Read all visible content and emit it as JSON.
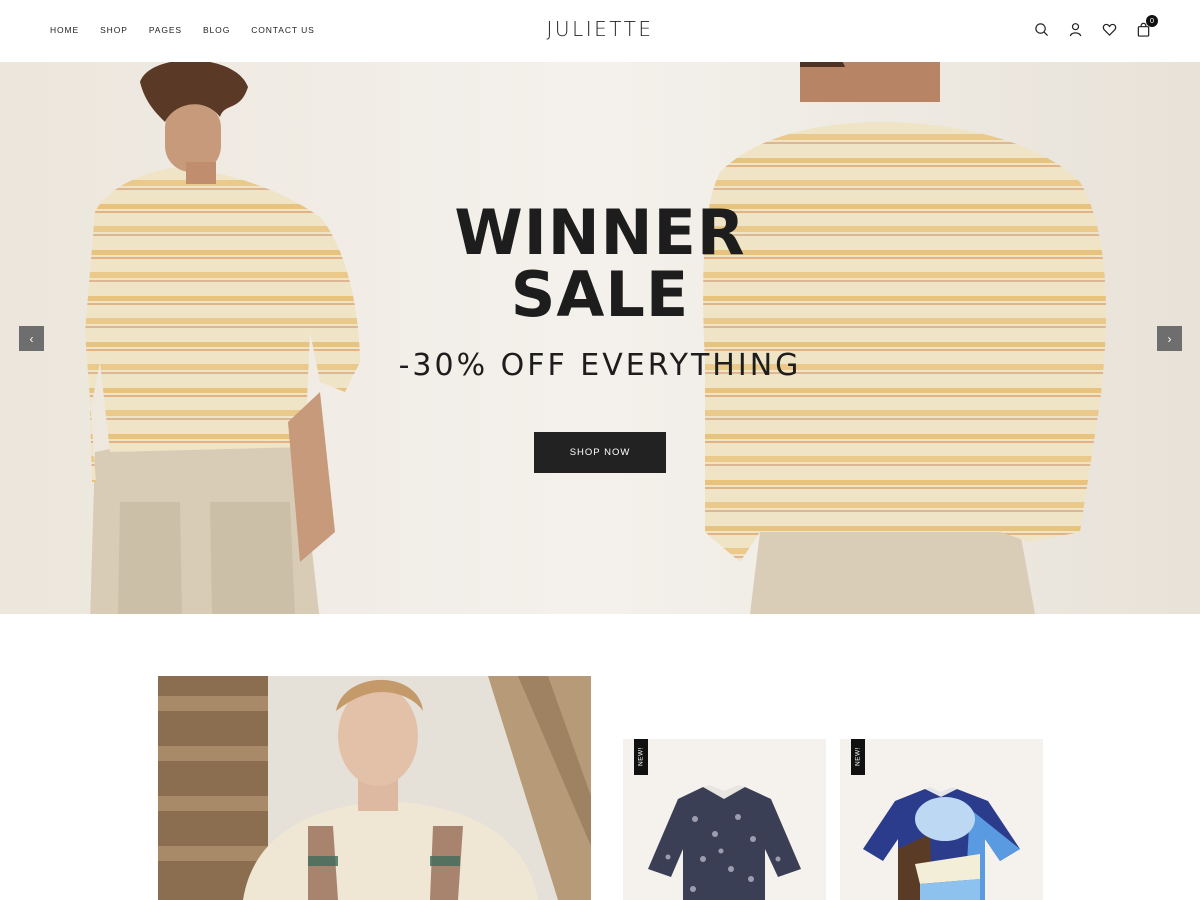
{
  "header": {
    "nav": [
      {
        "label": "HOME"
      },
      {
        "label": "SHOP"
      },
      {
        "label": "PAGES"
      },
      {
        "label": "BLOG"
      },
      {
        "label": "CONTACT US"
      }
    ],
    "logo": "JULIETTE",
    "icons": [
      "search-icon",
      "user-icon",
      "heart-icon",
      "bag-icon"
    ],
    "cart_count": "0"
  },
  "hero": {
    "title_line1": "WINNER",
    "title_line2": "SALE",
    "subtitle": "-30% OFF EVERYTHING",
    "cta": "SHOP NOW",
    "prev_arrow": "‹",
    "next_arrow": "›"
  },
  "products": [
    {
      "badge": "NEW!"
    },
    {
      "badge": "NEW!"
    }
  ],
  "colors": {
    "text": "#1f1f1f",
    "button_bg": "#222222",
    "arrow_bg": "#6e6e6e",
    "sweater": "#efe3c4",
    "sweater_stripe": "#e2b766",
    "pants": "#d8ccb6",
    "product_bg": "#f5f2ed"
  }
}
